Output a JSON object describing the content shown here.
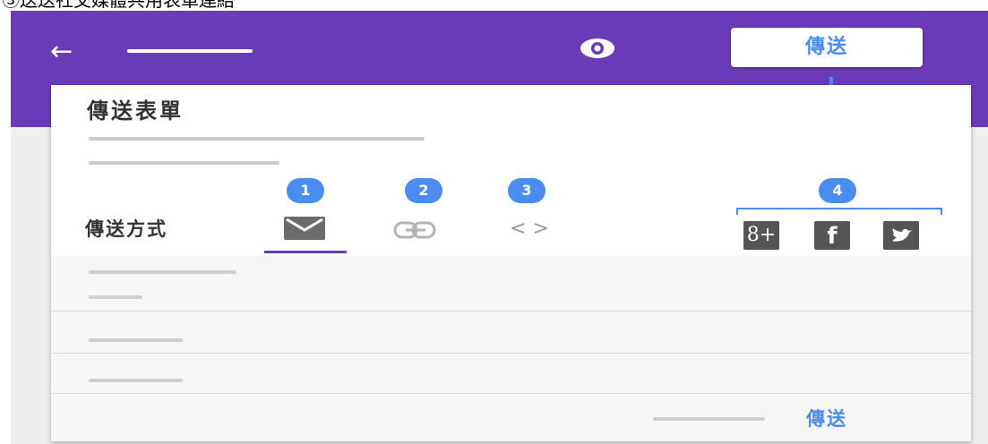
{
  "caption": "③送送社交媒體共用表單連結",
  "header": {
    "back_icon": "back-arrow-icon",
    "preview_icon": "eye-icon",
    "send_label": "傳送",
    "accent_color": "#6a3bb8"
  },
  "dialog": {
    "title": "傳送表單",
    "method_label": "傳送方式",
    "badges": [
      "1",
      "2",
      "3",
      "4"
    ],
    "tabs": [
      {
        "icon": "email-icon"
      },
      {
        "icon": "link-icon"
      },
      {
        "icon": "embed-code-icon",
        "glyph": "< >"
      }
    ],
    "social": [
      {
        "icon": "google-plus-icon",
        "glyph": "8+"
      },
      {
        "icon": "facebook-icon",
        "glyph": "f"
      },
      {
        "icon": "twitter-icon"
      }
    ],
    "send_label": "傳送",
    "link_color": "#4a8cf0"
  }
}
